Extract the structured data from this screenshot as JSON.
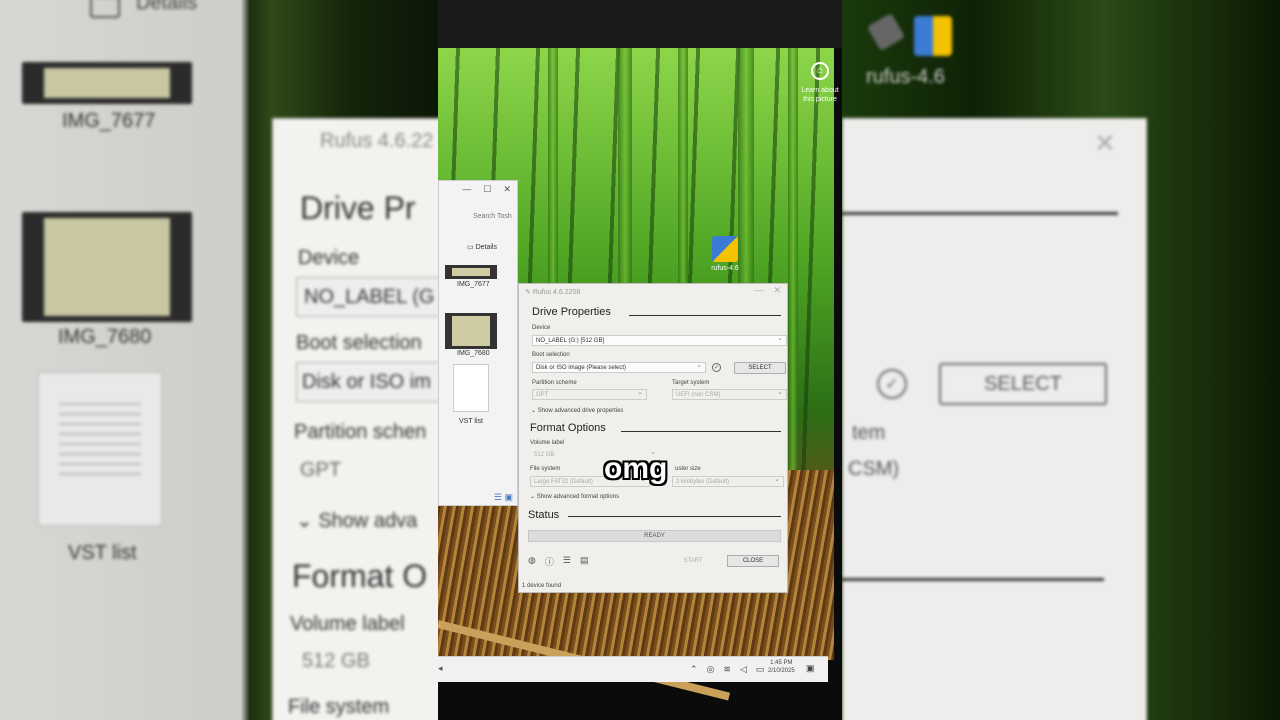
{
  "left_blur": {
    "details": "Details",
    "img1": "IMG_7677",
    "img2": "IMG_7680",
    "doc": "VST list",
    "rufus_title": "Rufus 4.6.22",
    "drive_props": "Drive Pr",
    "device": "Device",
    "device_value": "NO_LABEL (G",
    "boot": "Boot selection",
    "boot_value": "Disk or ISO im",
    "partition": "Partition schen",
    "partition_value": "GPT",
    "show_adv": "Show adva",
    "format": "Format O",
    "volume": "Volume label",
    "volume_value": "512 GB",
    "filesystem": "File system"
  },
  "right_blur": {
    "rufus_label": "rufus-4.6",
    "select": "SELECT",
    "target": "tem",
    "csm": "CSM)"
  },
  "desktop": {
    "learn": "Learn about this picture",
    "icon_label": "rufus-4.6"
  },
  "explorer": {
    "search": "Search Tosh",
    "details": "Details",
    "items": [
      {
        "label": "IMG_7677"
      },
      {
        "label": "IMG_7680"
      },
      {
        "label": "VST list"
      }
    ]
  },
  "rufus": {
    "title": "Rufus 4.6.2208",
    "drive_properties": "Drive Properties",
    "device_label": "Device",
    "device_value": "NO_LABEL (G:) [512 GB]",
    "boot_label": "Boot selection",
    "boot_value": "Disk or ISO image (Please select)",
    "select_button": "SELECT",
    "partition_label": "Partition scheme",
    "partition_value": "GPT",
    "target_label": "Target system",
    "target_value": "UEFI (non CSM)",
    "show_adv_drive": "Show advanced drive properties",
    "format_options": "Format Options",
    "volume_label": "Volume label",
    "volume_value": "512 GB",
    "fs_label": "File system",
    "fs_value": "Large FAT32 (Default)",
    "cluster_label": "uster size",
    "cluster_value": "2 kilobytes (Default)",
    "show_adv_format": "Show advanced format options",
    "status_heading": "Status",
    "status_value": "READY",
    "start_button": "START",
    "close_button": "CLOSE",
    "footer": "1 device found"
  },
  "taskbar": {
    "time": "1:45 PM",
    "date": "2/10/2025"
  },
  "caption": "omg"
}
